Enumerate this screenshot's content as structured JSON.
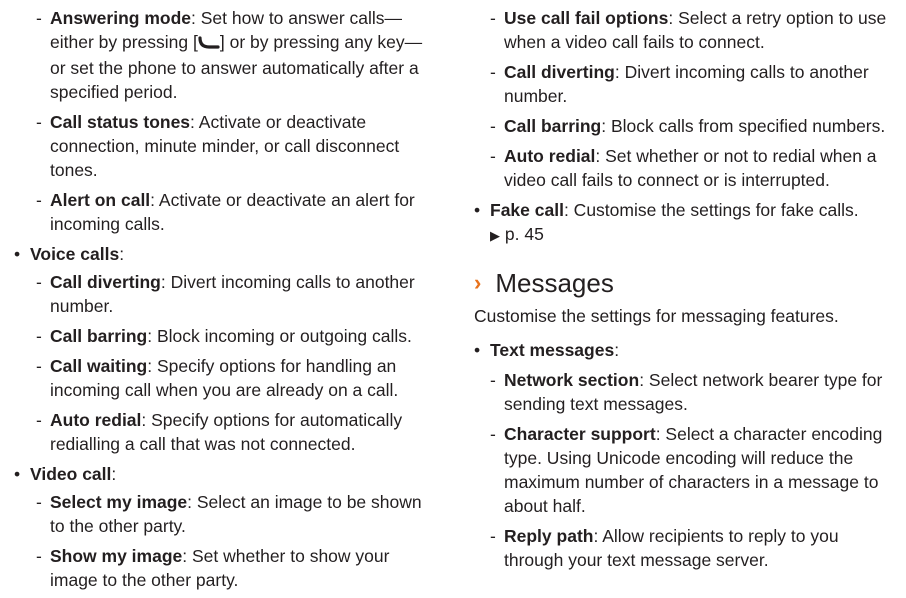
{
  "left": {
    "answering_mode": {
      "title": "Answering mode",
      "text_before": ": Set how to answer calls—either by pressing [",
      "text_after": "] or by pressing any key—or set the phone to answer automatically after a specified period."
    },
    "call_status_tones": {
      "title": "Call status tones",
      "text": ": Activate or deactivate connection, minute minder, or call disconnect tones."
    },
    "alert_on_call": {
      "title": "Alert on call",
      "text": ": Activate or deactivate an alert for incoming calls."
    },
    "voice_calls": {
      "title": "Voice calls",
      "suffix": ":"
    },
    "vc_call_diverting": {
      "title": "Call diverting",
      "text": ": Divert incoming calls to another number."
    },
    "vc_call_barring": {
      "title": "Call barring",
      "text": ": Block incoming or outgoing calls."
    },
    "vc_call_waiting": {
      "title": "Call waiting",
      "text": ": Specify options for handling an incoming call when you are already on a call."
    },
    "vc_auto_redial": {
      "title": "Auto redial",
      "text": ": Specify options for automatically redialling a call that was not connected."
    },
    "video_call": {
      "title": "Video call",
      "suffix": ":"
    },
    "select_my_image": {
      "title": "Select my image",
      "text": ": Select an image to be shown to the other party."
    },
    "show_my_image": {
      "title": "Show my image",
      "text": ": Set whether to show your image to the other party."
    }
  },
  "right": {
    "use_call_fail": {
      "title": "Use call fail options",
      "text": ": Select a retry option to use when a video call fails to connect."
    },
    "video_call_diverting": {
      "title": "Call diverting",
      "text": ": Divert incoming calls to another number."
    },
    "video_call_barring": {
      "title": "Call barring",
      "text": ": Block calls from specified numbers."
    },
    "video_auto_redial": {
      "title": "Auto redial",
      "text": ": Set whether or not to redial when a video call fails to connect or is interrupted."
    },
    "fake_call": {
      "title": "Fake call",
      "text": ": Customise the settings for fake calls.",
      "ref": "p. 45"
    },
    "messages_heading": "Messages",
    "messages_intro": "Customise the settings for messaging features.",
    "text_messages": {
      "title": "Text messages",
      "suffix": ":"
    },
    "network_section": {
      "title": "Network section",
      "text": ": Select network bearer type for sending text messages."
    },
    "character_support": {
      "title": "Character support",
      "text": ": Select a character encoding type. Using Unicode encoding will reduce the maximum number of characters in a message to about half."
    },
    "reply_path": {
      "title": "Reply path",
      "text": ": Allow recipients to reply to you through your text message server."
    }
  },
  "colors": {
    "text": "#231f20",
    "accent": "#e8721c"
  },
  "icons": {
    "call_key": "call-key-icon",
    "heading_chevron": "chevron-right-icon",
    "page_ref": "triangle-right-icon"
  }
}
